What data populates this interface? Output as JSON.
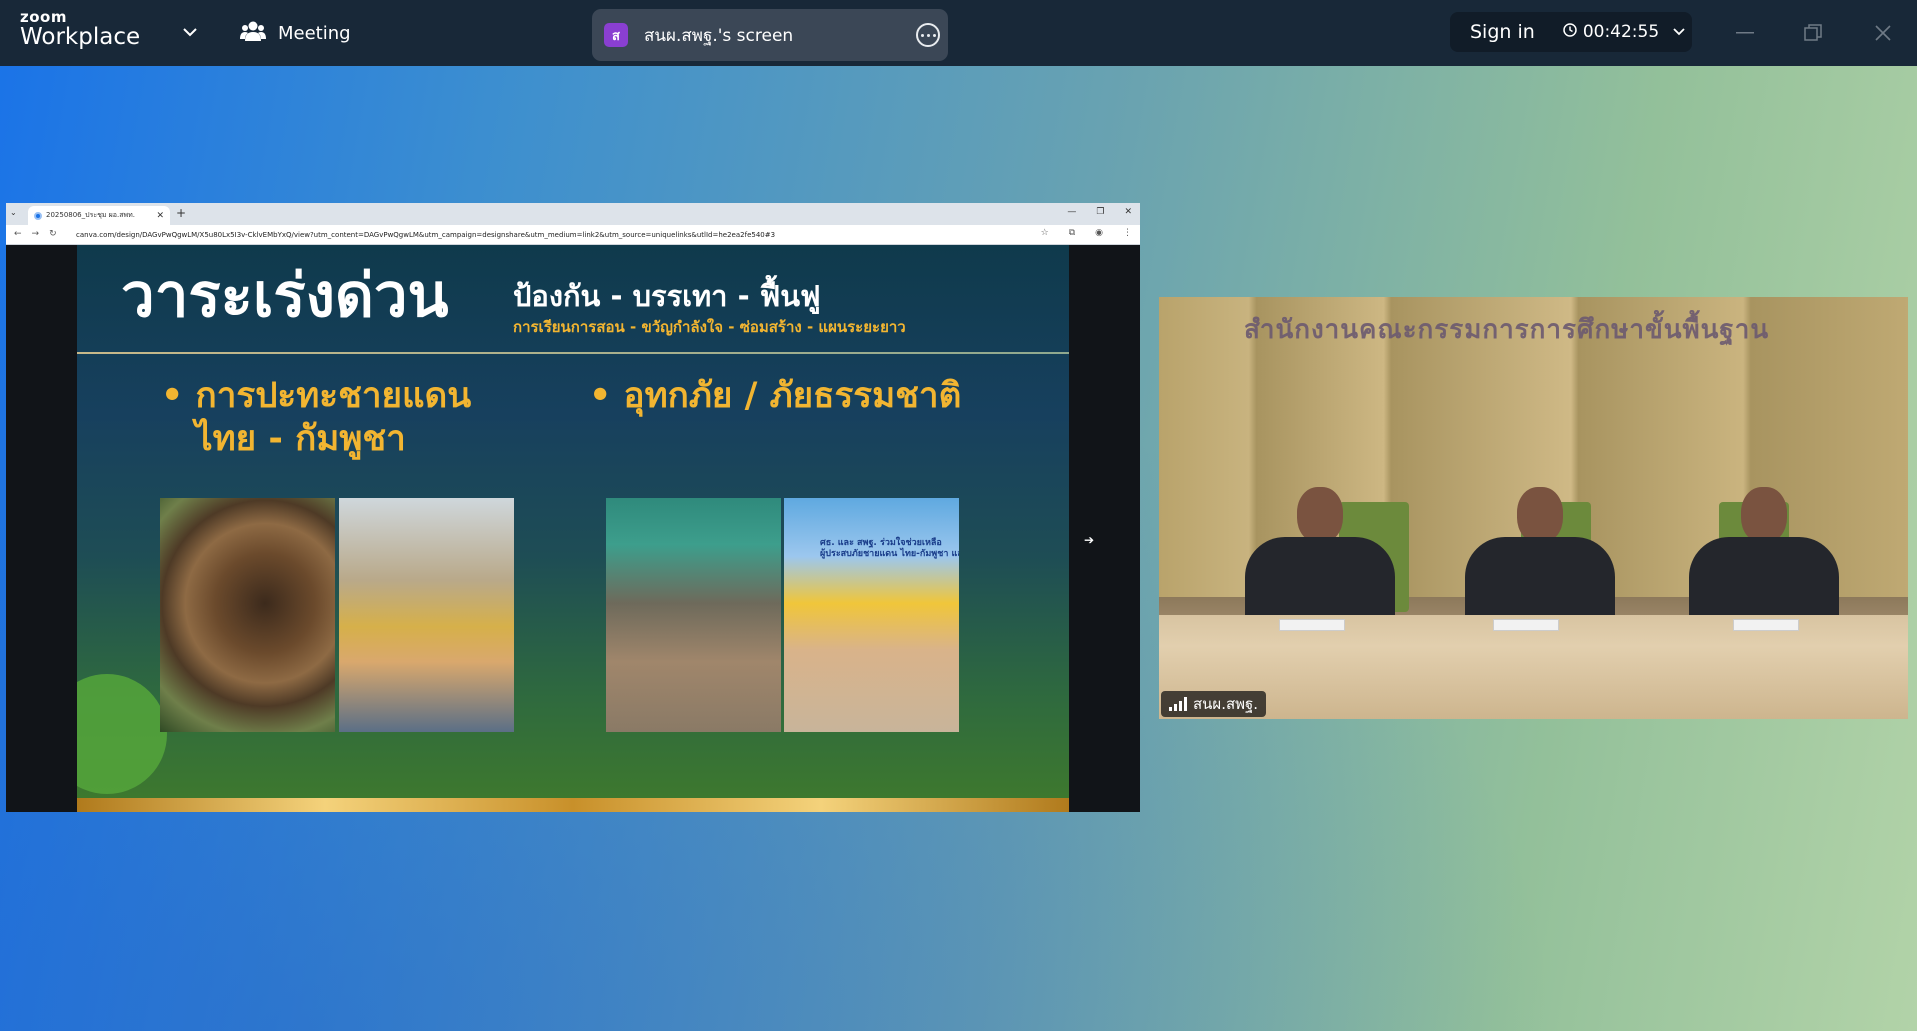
{
  "topbar": {
    "logo_line1": "zoom",
    "logo_line2": "Workplace",
    "meeting_label": "Meeting",
    "share": {
      "avatar_letter": "ส",
      "label": "สนผ.สพฐ.'s screen"
    },
    "signin_label": "Sign in",
    "timer": "00:42:55"
  },
  "browser": {
    "tab_title": "20250806_ประชุม ผอ.สพท.",
    "url": "canva.com/design/DAGvPwQgwLM/X5u80Lx5I3v-CklvEMbYxQ/view?utm_content=DAGvPwQgwLM&utm_campaign=designshare&utm_medium=link2&utm_source=uniquelinks&utlId=he2ea2fe540#3"
  },
  "slide": {
    "title": "วาระเร่งด่วน",
    "subtitle1": "ป้องกัน - บรรเทา - ฟื้นฟู",
    "subtitle2": "การเรียนการสอน - ขวัญกำลังใจ - ซ่อมสร้าง - แผนระยะยาว",
    "bullet_left_line1": "• การปะทะชายแดน",
    "bullet_left_line2": "ไทย - กัมพูชา",
    "bullet_right": "• อุทกภัย / ภัยธรรมชาติ",
    "photo_caption_line1": "ศธ. และ สพฐ. ร่วมใจช่วยเหลือ",
    "photo_caption_line2": "ผู้ประสบภัยชายแดน ไทย-กัมพูชา และ อุทกภัย"
  },
  "video": {
    "sign_text": "สำนักงานคณะกรรมการการศึกษาขั้นพื้นฐาน",
    "participant_name": "สนผ.สพฐ."
  },
  "colors": {
    "topbar_bg": "#182838",
    "slide_accent": "#f2b531",
    "avatar": "#8a3fd1"
  },
  "icons": [
    "chevron-down-icon",
    "participants-icon",
    "more-icon",
    "clock-icon",
    "minimize-icon",
    "restore-icon",
    "close-icon",
    "signal-icon"
  ]
}
